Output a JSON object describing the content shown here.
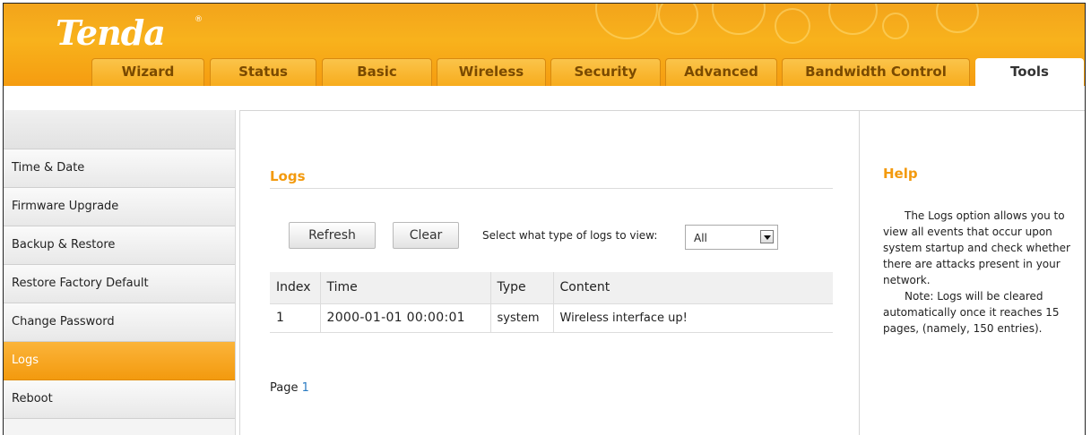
{
  "brand": {
    "logo": "Tenda",
    "reg": "®"
  },
  "nav": {
    "tabs": [
      {
        "label": "Wizard"
      },
      {
        "label": "Status"
      },
      {
        "label": "Basic"
      },
      {
        "label": "Wireless"
      },
      {
        "label": "Security"
      },
      {
        "label": "Advanced"
      },
      {
        "label": "Bandwidth Control"
      },
      {
        "label": "Tools",
        "active": true
      }
    ]
  },
  "sidebar": {
    "items": [
      {
        "label": "Time & Date"
      },
      {
        "label": "Firmware Upgrade"
      },
      {
        "label": "Backup & Restore"
      },
      {
        "label": "Restore Factory Default"
      },
      {
        "label": "Change Password"
      },
      {
        "label": "Logs",
        "active": true
      },
      {
        "label": "Reboot"
      }
    ]
  },
  "main": {
    "title": "Logs",
    "refresh_label": "Refresh",
    "clear_label": "Clear",
    "select_label": "Select what type of logs to view:",
    "select_value": "All",
    "table": {
      "headers": [
        "Index",
        "Time",
        "Type",
        "Content"
      ],
      "rows": [
        [
          "1",
          "2000-01-01 00:00:01",
          "system",
          "Wireless interface up!"
        ]
      ]
    },
    "pager": {
      "label": "Page",
      "current": "1"
    }
  },
  "help": {
    "title": "Help",
    "paragraphs": [
      "The Logs option allows you to view all events that occur upon system startup and check whether there are attacks present in your network.",
      "Note: Logs will be cleared automatically once it reaches 15 pages, (namely, 150 entries)."
    ]
  },
  "colors": {
    "accent": "#f39a0e",
    "header": "#f8b21c",
    "link": "#2a7bc2"
  }
}
